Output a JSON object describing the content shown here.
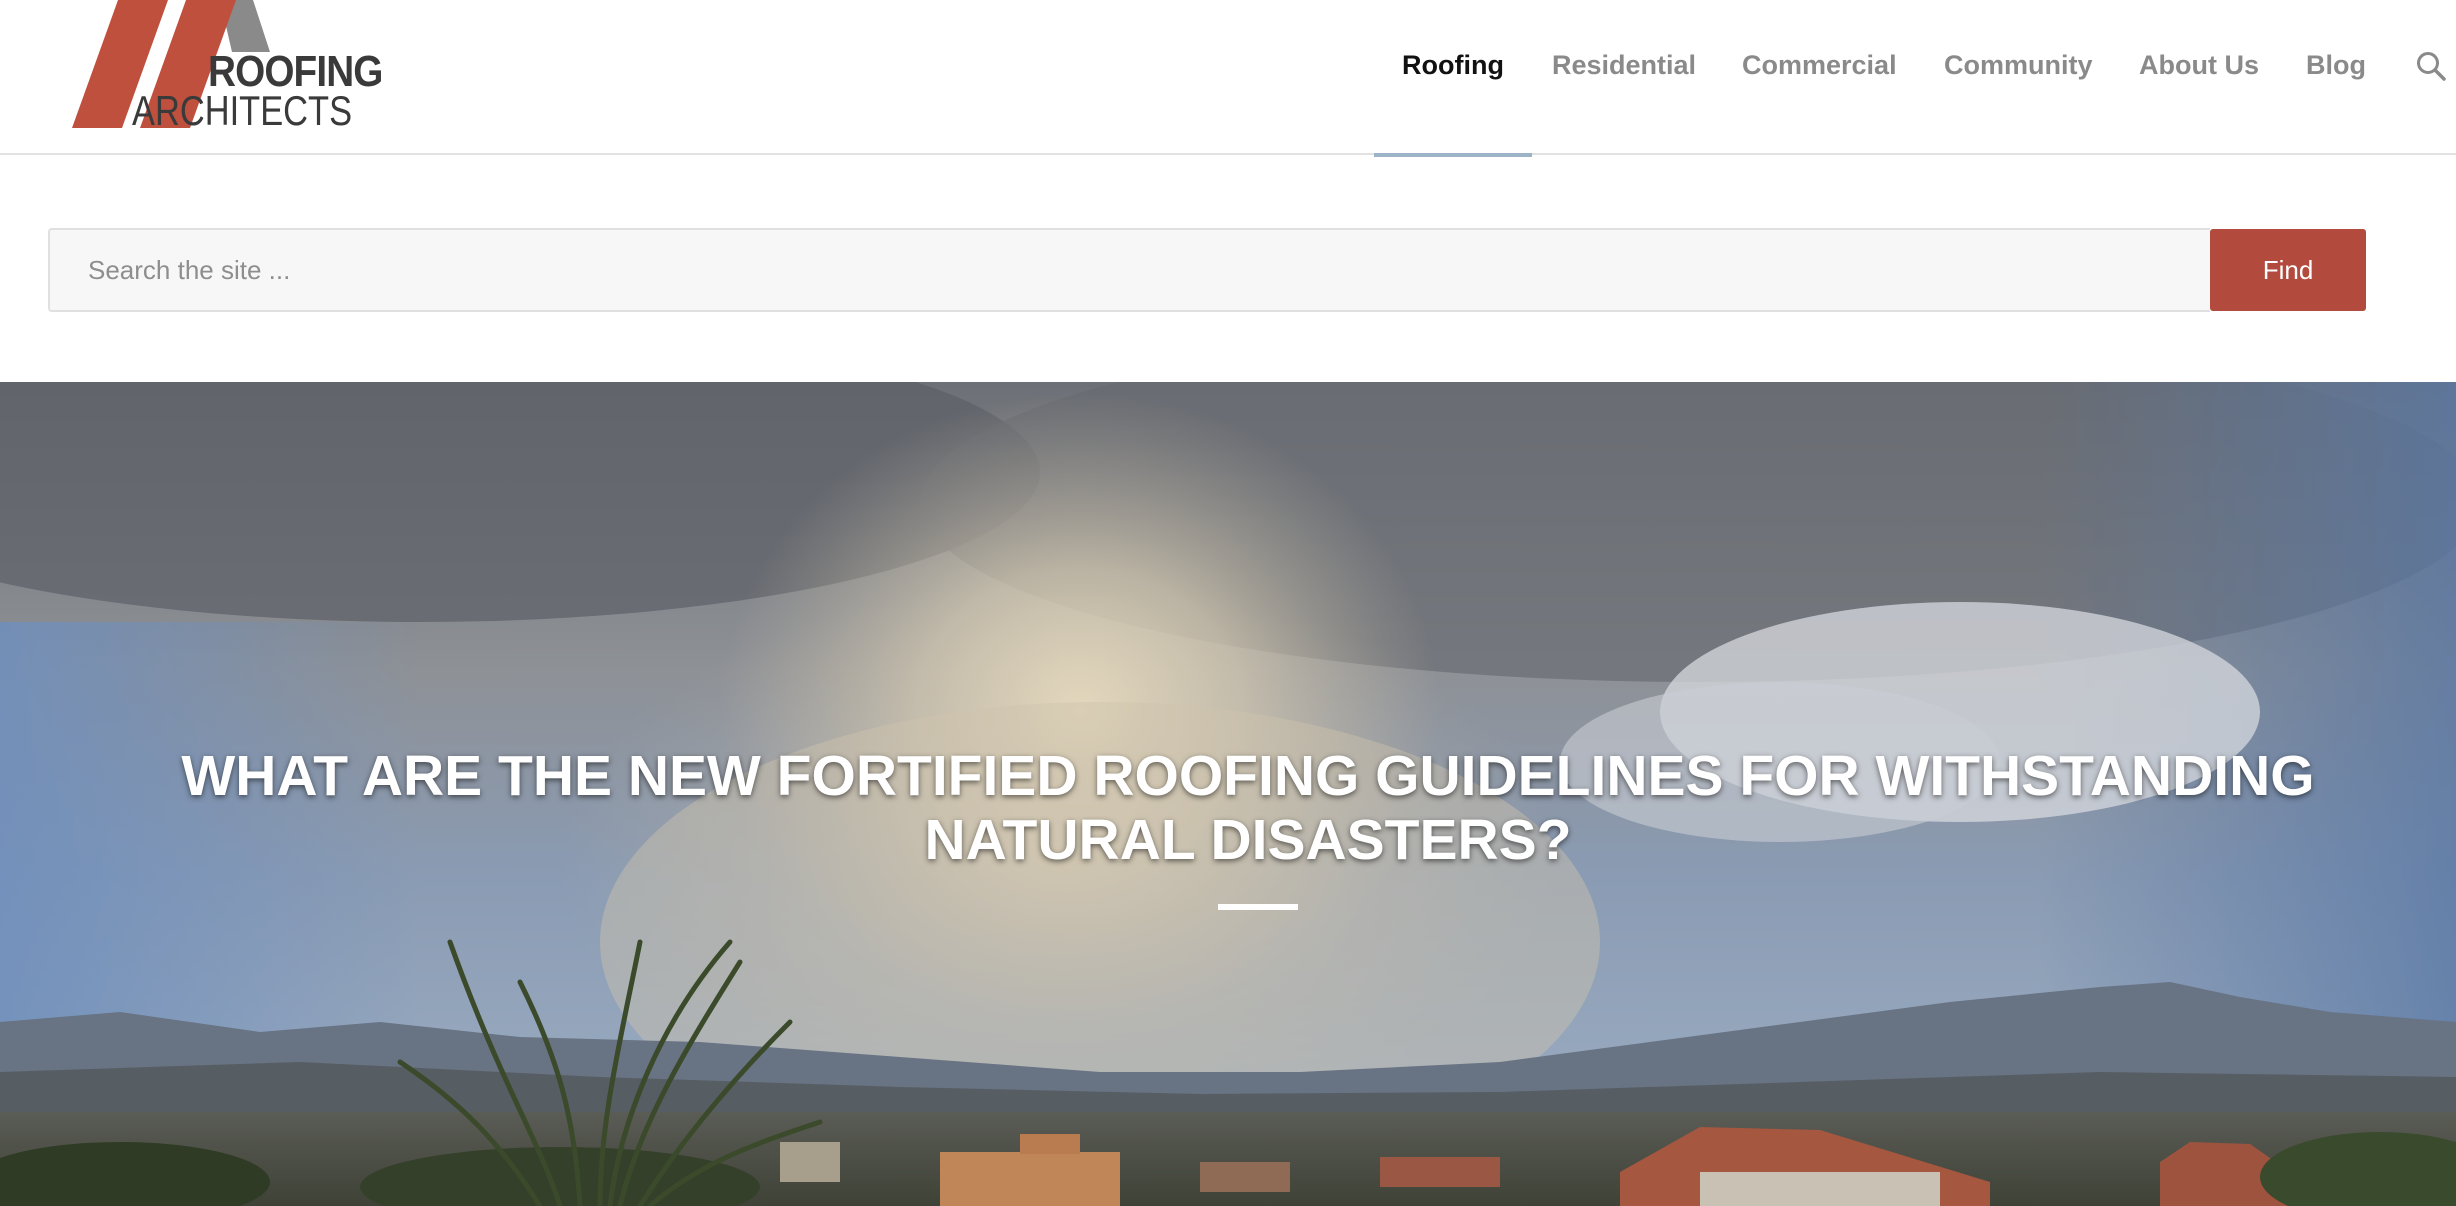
{
  "logo": {
    "word_1": "ROOFING",
    "word_2": "ARCHITECTS",
    "colors": {
      "primary_red": "#c0503e",
      "gray": "#8a8a8a",
      "text": "#3a3a3a"
    }
  },
  "nav": {
    "items": [
      {
        "label": "Roofing",
        "active": true
      },
      {
        "label": "Residential",
        "active": false
      },
      {
        "label": "Commercial",
        "active": false
      },
      {
        "label": "Community",
        "active": false
      },
      {
        "label": "About Us",
        "active": false
      },
      {
        "label": "Blog",
        "active": false
      }
    ],
    "search_icon": "search-icon",
    "active_underline_color": "#9db4c8"
  },
  "search": {
    "placeholder": "Search the site ...",
    "value": "",
    "button_label": "Find",
    "button_color": "#b24a3e"
  },
  "hero": {
    "title": "What are the new fortified roofing guidelines for withstanding natural disasters?"
  }
}
